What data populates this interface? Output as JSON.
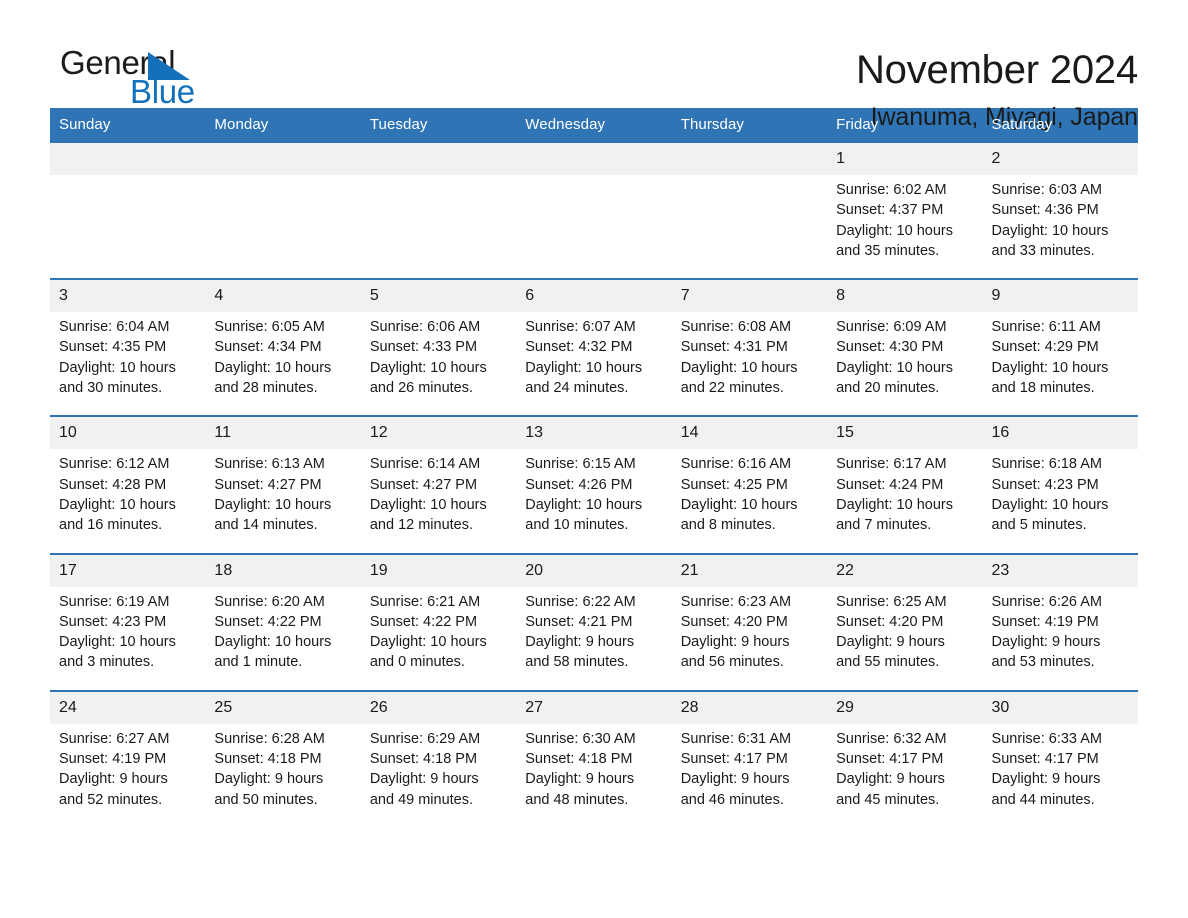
{
  "brand": {
    "name_part1": "General",
    "name_part2": "Blue",
    "logo_mark": "blue-triangle-icon",
    "accent_color": "#1371bb"
  },
  "header": {
    "title": "November 2024",
    "subtitle": "Iwanuma, Miyagi, Japan"
  },
  "theme": {
    "header_blue": "#2f75b5",
    "daynum_gray": "#f1f1f1",
    "text": "#1a1a1a"
  },
  "weekday_headers": [
    "Sunday",
    "Monday",
    "Tuesday",
    "Wednesday",
    "Thursday",
    "Friday",
    "Saturday"
  ],
  "weeks": [
    [
      {
        "day": "",
        "sunrise": "",
        "sunset": "",
        "daylight_line1": "",
        "daylight_line2": ""
      },
      {
        "day": "",
        "sunrise": "",
        "sunset": "",
        "daylight_line1": "",
        "daylight_line2": ""
      },
      {
        "day": "",
        "sunrise": "",
        "sunset": "",
        "daylight_line1": "",
        "daylight_line2": ""
      },
      {
        "day": "",
        "sunrise": "",
        "sunset": "",
        "daylight_line1": "",
        "daylight_line2": ""
      },
      {
        "day": "",
        "sunrise": "",
        "sunset": "",
        "daylight_line1": "",
        "daylight_line2": ""
      },
      {
        "day": "1",
        "sunrise": "Sunrise: 6:02 AM",
        "sunset": "Sunset: 4:37 PM",
        "daylight_line1": "Daylight: 10 hours",
        "daylight_line2": "and 35 minutes."
      },
      {
        "day": "2",
        "sunrise": "Sunrise: 6:03 AM",
        "sunset": "Sunset: 4:36 PM",
        "daylight_line1": "Daylight: 10 hours",
        "daylight_line2": "and 33 minutes."
      }
    ],
    [
      {
        "day": "3",
        "sunrise": "Sunrise: 6:04 AM",
        "sunset": "Sunset: 4:35 PM",
        "daylight_line1": "Daylight: 10 hours",
        "daylight_line2": "and 30 minutes."
      },
      {
        "day": "4",
        "sunrise": "Sunrise: 6:05 AM",
        "sunset": "Sunset: 4:34 PM",
        "daylight_line1": "Daylight: 10 hours",
        "daylight_line2": "and 28 minutes."
      },
      {
        "day": "5",
        "sunrise": "Sunrise: 6:06 AM",
        "sunset": "Sunset: 4:33 PM",
        "daylight_line1": "Daylight: 10 hours",
        "daylight_line2": "and 26 minutes."
      },
      {
        "day": "6",
        "sunrise": "Sunrise: 6:07 AM",
        "sunset": "Sunset: 4:32 PM",
        "daylight_line1": "Daylight: 10 hours",
        "daylight_line2": "and 24 minutes."
      },
      {
        "day": "7",
        "sunrise": "Sunrise: 6:08 AM",
        "sunset": "Sunset: 4:31 PM",
        "daylight_line1": "Daylight: 10 hours",
        "daylight_line2": "and 22 minutes."
      },
      {
        "day": "8",
        "sunrise": "Sunrise: 6:09 AM",
        "sunset": "Sunset: 4:30 PM",
        "daylight_line1": "Daylight: 10 hours",
        "daylight_line2": "and 20 minutes."
      },
      {
        "day": "9",
        "sunrise": "Sunrise: 6:11 AM",
        "sunset": "Sunset: 4:29 PM",
        "daylight_line1": "Daylight: 10 hours",
        "daylight_line2": "and 18 minutes."
      }
    ],
    [
      {
        "day": "10",
        "sunrise": "Sunrise: 6:12 AM",
        "sunset": "Sunset: 4:28 PM",
        "daylight_line1": "Daylight: 10 hours",
        "daylight_line2": "and 16 minutes."
      },
      {
        "day": "11",
        "sunrise": "Sunrise: 6:13 AM",
        "sunset": "Sunset: 4:27 PM",
        "daylight_line1": "Daylight: 10 hours",
        "daylight_line2": "and 14 minutes."
      },
      {
        "day": "12",
        "sunrise": "Sunrise: 6:14 AM",
        "sunset": "Sunset: 4:27 PM",
        "daylight_line1": "Daylight: 10 hours",
        "daylight_line2": "and 12 minutes."
      },
      {
        "day": "13",
        "sunrise": "Sunrise: 6:15 AM",
        "sunset": "Sunset: 4:26 PM",
        "daylight_line1": "Daylight: 10 hours",
        "daylight_line2": "and 10 minutes."
      },
      {
        "day": "14",
        "sunrise": "Sunrise: 6:16 AM",
        "sunset": "Sunset: 4:25 PM",
        "daylight_line1": "Daylight: 10 hours",
        "daylight_line2": "and 8 minutes."
      },
      {
        "day": "15",
        "sunrise": "Sunrise: 6:17 AM",
        "sunset": "Sunset: 4:24 PM",
        "daylight_line1": "Daylight: 10 hours",
        "daylight_line2": "and 7 minutes."
      },
      {
        "day": "16",
        "sunrise": "Sunrise: 6:18 AM",
        "sunset": "Sunset: 4:23 PM",
        "daylight_line1": "Daylight: 10 hours",
        "daylight_line2": "and 5 minutes."
      }
    ],
    [
      {
        "day": "17",
        "sunrise": "Sunrise: 6:19 AM",
        "sunset": "Sunset: 4:23 PM",
        "daylight_line1": "Daylight: 10 hours",
        "daylight_line2": "and 3 minutes."
      },
      {
        "day": "18",
        "sunrise": "Sunrise: 6:20 AM",
        "sunset": "Sunset: 4:22 PM",
        "daylight_line1": "Daylight: 10 hours",
        "daylight_line2": "and 1 minute."
      },
      {
        "day": "19",
        "sunrise": "Sunrise: 6:21 AM",
        "sunset": "Sunset: 4:22 PM",
        "daylight_line1": "Daylight: 10 hours",
        "daylight_line2": "and 0 minutes."
      },
      {
        "day": "20",
        "sunrise": "Sunrise: 6:22 AM",
        "sunset": "Sunset: 4:21 PM",
        "daylight_line1": "Daylight: 9 hours",
        "daylight_line2": "and 58 minutes."
      },
      {
        "day": "21",
        "sunrise": "Sunrise: 6:23 AM",
        "sunset": "Sunset: 4:20 PM",
        "daylight_line1": "Daylight: 9 hours",
        "daylight_line2": "and 56 minutes."
      },
      {
        "day": "22",
        "sunrise": "Sunrise: 6:25 AM",
        "sunset": "Sunset: 4:20 PM",
        "daylight_line1": "Daylight: 9 hours",
        "daylight_line2": "and 55 minutes."
      },
      {
        "day": "23",
        "sunrise": "Sunrise: 6:26 AM",
        "sunset": "Sunset: 4:19 PM",
        "daylight_line1": "Daylight: 9 hours",
        "daylight_line2": "and 53 minutes."
      }
    ],
    [
      {
        "day": "24",
        "sunrise": "Sunrise: 6:27 AM",
        "sunset": "Sunset: 4:19 PM",
        "daylight_line1": "Daylight: 9 hours",
        "daylight_line2": "and 52 minutes."
      },
      {
        "day": "25",
        "sunrise": "Sunrise: 6:28 AM",
        "sunset": "Sunset: 4:18 PM",
        "daylight_line1": "Daylight: 9 hours",
        "daylight_line2": "and 50 minutes."
      },
      {
        "day": "26",
        "sunrise": "Sunrise: 6:29 AM",
        "sunset": "Sunset: 4:18 PM",
        "daylight_line1": "Daylight: 9 hours",
        "daylight_line2": "and 49 minutes."
      },
      {
        "day": "27",
        "sunrise": "Sunrise: 6:30 AM",
        "sunset": "Sunset: 4:18 PM",
        "daylight_line1": "Daylight: 9 hours",
        "daylight_line2": "and 48 minutes."
      },
      {
        "day": "28",
        "sunrise": "Sunrise: 6:31 AM",
        "sunset": "Sunset: 4:17 PM",
        "daylight_line1": "Daylight: 9 hours",
        "daylight_line2": "and 46 minutes."
      },
      {
        "day": "29",
        "sunrise": "Sunrise: 6:32 AM",
        "sunset": "Sunset: 4:17 PM",
        "daylight_line1": "Daylight: 9 hours",
        "daylight_line2": "and 45 minutes."
      },
      {
        "day": "30",
        "sunrise": "Sunrise: 6:33 AM",
        "sunset": "Sunset: 4:17 PM",
        "daylight_line1": "Daylight: 9 hours",
        "daylight_line2": "and 44 minutes."
      }
    ]
  ]
}
